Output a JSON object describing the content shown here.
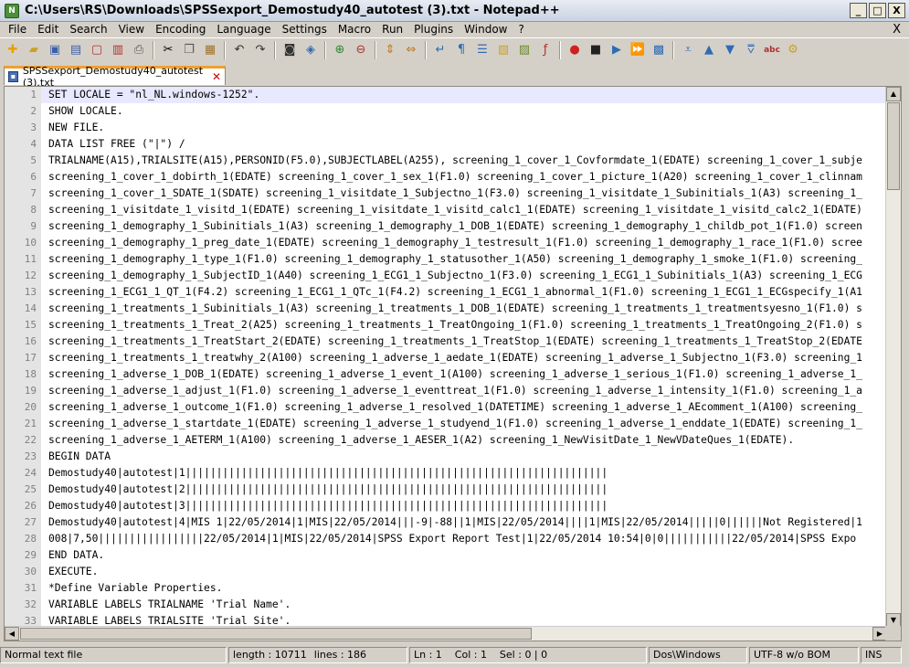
{
  "window": {
    "title": "C:\\Users\\RS\\Downloads\\SPSSexport_Demostudy40_autotest (3).txt - Notepad++",
    "minimize": "_",
    "maximize": "□",
    "close": "X"
  },
  "menu": [
    "File",
    "Edit",
    "Search",
    "View",
    "Encoding",
    "Language",
    "Settings",
    "Macro",
    "Run",
    "Plugins",
    "Window",
    "?"
  ],
  "doc_close": "X",
  "toolbar_icons": [
    "new-file-icon",
    "open-file-icon",
    "save-icon",
    "save-all-icon",
    "close-icon",
    "close-all-icon",
    "print-icon",
    "cut-icon",
    "copy-icon",
    "paste-icon",
    "undo-icon",
    "redo-icon",
    "find-icon",
    "replace-icon",
    "zoom-in-icon",
    "zoom-out-icon",
    "sync-vertical-icon",
    "sync-horizontal-icon",
    "word-wrap-icon",
    "show-all-chars-icon",
    "indent-guide-icon",
    "user-language-icon",
    "doc-map-icon",
    "function-list-icon",
    "record-macro-icon",
    "stop-macro-icon",
    "play-macro-icon",
    "run-macro-multiple-icon",
    "save-macro-icon",
    "up-icon",
    "down-icon",
    "fold-icon",
    "spellcheck-icon",
    "plugin-icon"
  ],
  "tab": {
    "label": "SPSSexport_Demostudy40_autotest (3).txt"
  },
  "editor": {
    "line_numbers": [
      "1",
      "2",
      "3",
      "4",
      "5",
      "6",
      "7",
      "8",
      "9",
      "10",
      "11",
      "12",
      "13",
      "14",
      "15",
      "16",
      "17",
      "18",
      "19",
      "20",
      "21",
      "22",
      "23",
      "24",
      "25",
      "26",
      "27",
      "28",
      "29",
      "30",
      "31",
      "32",
      "33"
    ],
    "lines": [
      "SET LOCALE = \"nl_NL.windows-1252\".",
      "SHOW LOCALE.",
      "NEW FILE.",
      "DATA LIST FREE (\"|\") /",
      "TRIALNAME(A15),TRIALSITE(A15),PERSONID(F5.0),SUBJECTLABEL(A255), screening_1_cover_1_Covformdate_1(EDATE) screening_1_cover_1_subje",
      "screening_1_cover_1_dobirth_1(EDATE) screening_1_cover_1_sex_1(F1.0) screening_1_cover_1_picture_1(A20) screening_1_cover_1_clinnam",
      "screening_1_cover_1_SDATE_1(SDATE) screening_1_visitdate_1_Subjectno_1(F3.0) screening_1_visitdate_1_Subinitials_1(A3) screening_1_",
      "screening_1_visitdate_1_visitd_1(EDATE) screening_1_visitdate_1_visitd_calc1_1(EDATE) screening_1_visitdate_1_visitd_calc2_1(EDATE)",
      "screening_1_demography_1_Subinitials_1(A3) screening_1_demography_1_DOB_1(EDATE) screening_1_demography_1_childb_pot_1(F1.0) screen",
      "screening_1_demography_1_preg_date_1(EDATE) screening_1_demography_1_testresult_1(F1.0) screening_1_demography_1_race_1(F1.0) scree",
      "screening_1_demography_1_type_1(F1.0) screening_1_demography_1_statusother_1(A50) screening_1_demography_1_smoke_1(F1.0) screening_",
      "screening_1_demography_1_SubjectID_1(A40) screening_1_ECG1_1_Subjectno_1(F3.0) screening_1_ECG1_1_Subinitials_1(A3) screening_1_ECG",
      "screening_1_ECG1_1_QT_1(F4.2) screening_1_ECG1_1_QTc_1(F4.2) screening_1_ECG1_1_abnormal_1(F1.0) screening_1_ECG1_1_ECGspecify_1(A1",
      "screening_1_treatments_1_Subinitials_1(A3) screening_1_treatments_1_DOB_1(EDATE) screening_1_treatments_1_treatmentsyesno_1(F1.0) s",
      "screening_1_treatments_1_Treat_2(A25) screening_1_treatments_1_TreatOngoing_1(F1.0) screening_1_treatments_1_TreatOngoing_2(F1.0) s",
      "screening_1_treatments_1_TreatStart_2(EDATE) screening_1_treatments_1_TreatStop_1(EDATE) screening_1_treatments_1_TreatStop_2(EDATE",
      "screening_1_treatments_1_treatwhy_2(A100) screening_1_adverse_1_aedate_1(EDATE) screening_1_adverse_1_Subjectno_1(F3.0) screening_1",
      "screening_1_adverse_1_DOB_1(EDATE) screening_1_adverse_1_event_1(A100) screening_1_adverse_1_serious_1(F1.0) screening_1_adverse_1_",
      "screening_1_adverse_1_adjust_1(F1.0) screening_1_adverse_1_eventtreat_1(F1.0) screening_1_adverse_1_intensity_1(F1.0) screening_1_a",
      "screening_1_adverse_1_outcome_1(F1.0) screening_1_adverse_1_resolved_1(DATETIME) screening_1_adverse_1_AEcomment_1(A100) screening_",
      "screening_1_adverse_1_startdate_1(EDATE) screening_1_adverse_1_studyend_1(F1.0) screening_1_adverse_1_enddate_1(EDATE) screening_1_",
      "screening_1_adverse_1_AETERM_1(A100) screening_1_adverse_1_AESER_1(A2) screening_1_NewVisitDate_1_NewVDateQues_1(EDATE).",
      "BEGIN DATA",
      "Demostudy40|autotest|1||||||||||||||||||||||||||||||||||||||||||||||||||||||||||||||||||||",
      "Demostudy40|autotest|2||||||||||||||||||||||||||||||||||||||||||||||||||||||||||||||||||||",
      "Demostudy40|autotest|3||||||||||||||||||||||||||||||||||||||||||||||||||||||||||||||||||||",
      "Demostudy40|autotest|4|MIS 1|22/05/2014|1|MIS|22/05/2014|||-9|-88||1|MIS|22/05/2014||||1|MIS|22/05/2014|||||0||||||Not Registered|1",
      "008|7,50|||||||||||||||||22/05/2014|1|MIS|22/05/2014|SPSS Export Report Test|1|22/05/2014 10:54|0|0|||||||||||22/05/2014|SPSS Expo",
      "END DATA.",
      "EXECUTE.",
      "*Define Variable Properties.",
      "VARIABLE LABELS TRIALNAME 'Trial Name'.",
      "VARIABLE LABELS TRIALSITE 'Trial Site'."
    ]
  },
  "statusbar": {
    "type": "Normal text file",
    "length": "length : 10711",
    "lines": "lines : 186",
    "position": "Ln : 1    Col : 1    Sel : 0 | 0",
    "eol": "Dos\\Windows",
    "encoding": "UTF-8 w/o BOM",
    "mode": "INS"
  }
}
